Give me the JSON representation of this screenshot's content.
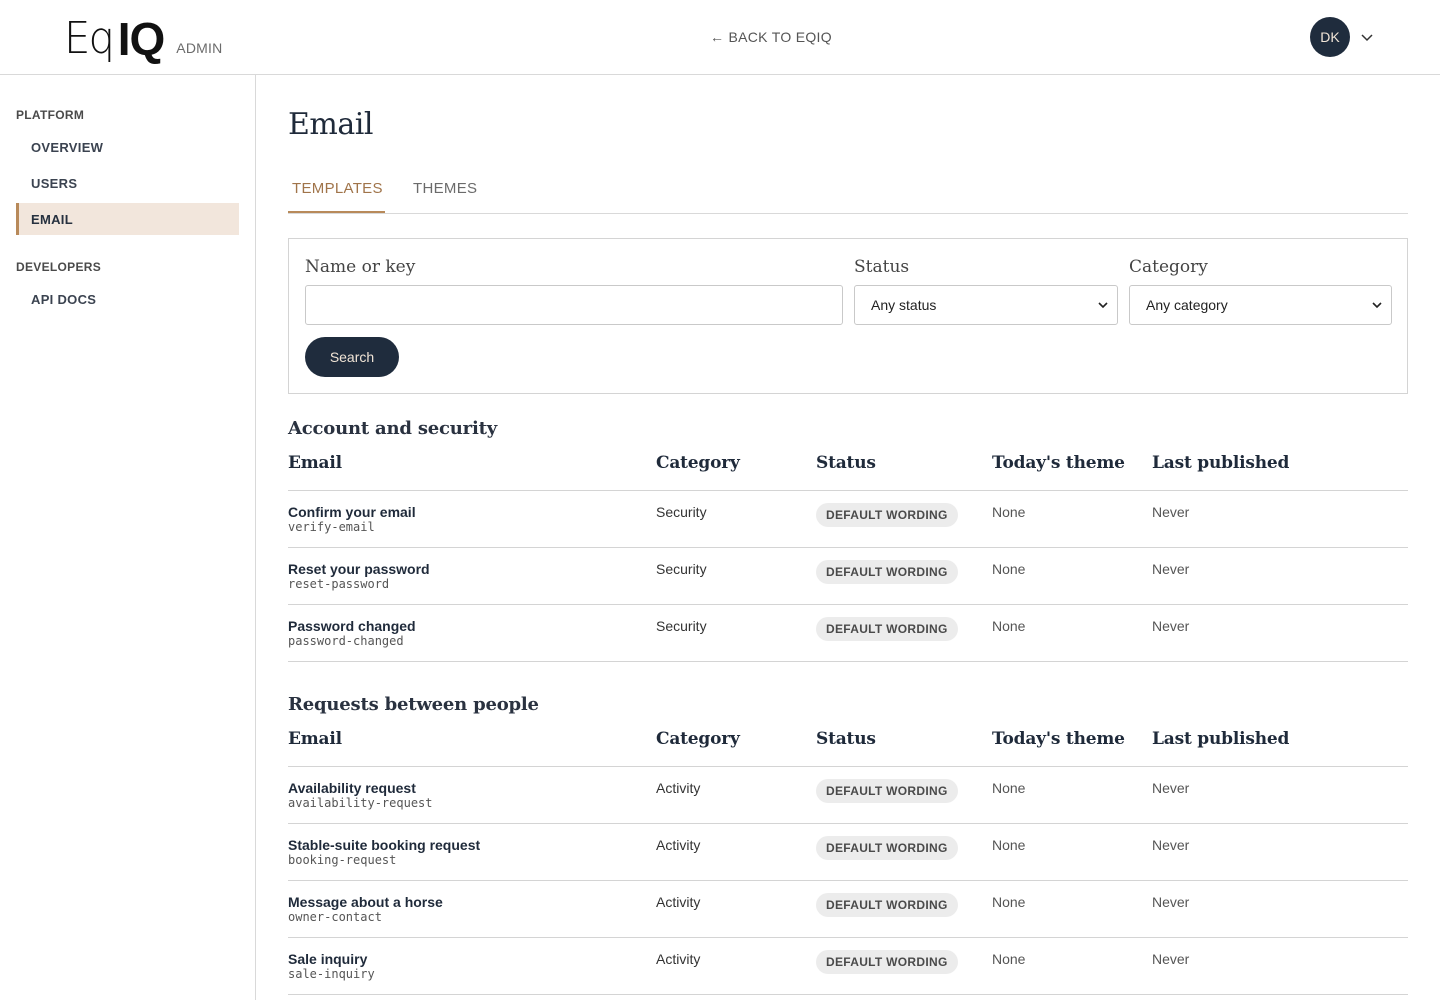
{
  "header": {
    "logo_left": "Eq",
    "logo_right": "IQ",
    "logo_suffix": "ADMIN",
    "back_link": "← BACK TO EQIQ",
    "avatar_initials": "DK"
  },
  "sidebar": {
    "sections": [
      {
        "title": "PLATFORM",
        "items": [
          "OVERVIEW",
          "USERS",
          "EMAIL"
        ]
      },
      {
        "title": "DEVELOPERS",
        "items": [
          "API DOCS"
        ]
      }
    ],
    "active_item": "EMAIL"
  },
  "page": {
    "title": "Email",
    "tabs": [
      "TEMPLATES",
      "THEMES"
    ],
    "active_tab": "TEMPLATES"
  },
  "filters": {
    "name_label": "Name or key",
    "name_value": "",
    "status_label": "Status",
    "status_value": "Any status",
    "category_label": "Category",
    "category_value": "Any category",
    "search_button": "Search"
  },
  "columns": [
    "Email",
    "Category",
    "Status",
    "Today's theme",
    "Last published"
  ],
  "groups": [
    {
      "title": "Account and security",
      "rows": [
        {
          "name": "Confirm your email",
          "key": "verify-email",
          "category": "Security",
          "status": "DEFAULT WORDING",
          "theme": "None",
          "published": "Never"
        },
        {
          "name": "Reset your password",
          "key": "reset-password",
          "category": "Security",
          "status": "DEFAULT WORDING",
          "theme": "None",
          "published": "Never"
        },
        {
          "name": "Password changed",
          "key": "password-changed",
          "category": "Security",
          "status": "DEFAULT WORDING",
          "theme": "None",
          "published": "Never"
        }
      ]
    },
    {
      "title": "Requests between people",
      "rows": [
        {
          "name": "Availability request",
          "key": "availability-request",
          "category": "Activity",
          "status": "DEFAULT WORDING",
          "theme": "None",
          "published": "Never"
        },
        {
          "name": "Stable-suite booking request",
          "key": "booking-request",
          "category": "Activity",
          "status": "DEFAULT WORDING",
          "theme": "None",
          "published": "Never"
        },
        {
          "name": "Message about a horse",
          "key": "owner-contact",
          "category": "Activity",
          "status": "DEFAULT WORDING",
          "theme": "None",
          "published": "Never"
        },
        {
          "name": "Sale inquiry",
          "key": "sale-inquiry",
          "category": "Activity",
          "status": "DEFAULT WORDING",
          "theme": "None",
          "published": "Never"
        }
      ]
    }
  ],
  "colors": {
    "accent": "#b88a5a",
    "navy": "#1f2c3d",
    "active_bg": "#f2e6dc"
  }
}
